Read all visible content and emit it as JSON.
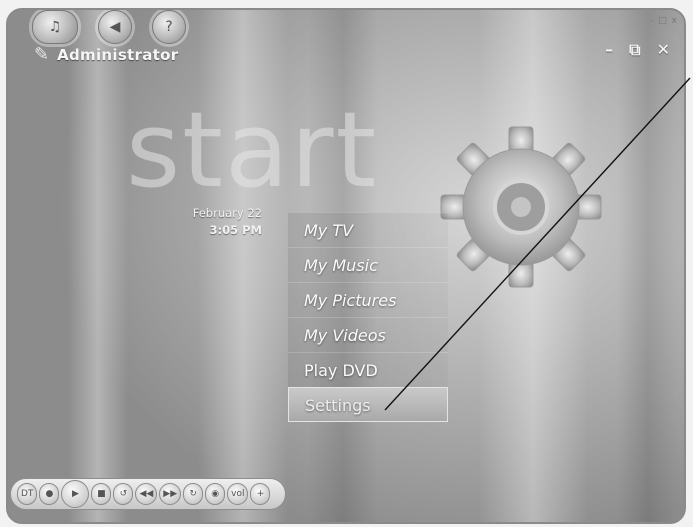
{
  "header": {
    "user_name": "Administrator",
    "title_mini": "- □ x",
    "minimize_label": "–",
    "restore_label": "⧉",
    "close_label": "✕"
  },
  "top_buttons": [
    {
      "icon": "media-center-logo-icon",
      "glyph": "♫"
    },
    {
      "icon": "back-icon",
      "glyph": "◀"
    },
    {
      "icon": "help-icon",
      "glyph": "?"
    }
  ],
  "watermark": {
    "text": "start"
  },
  "datetime": {
    "date": "February 22",
    "time": "3:05 PM"
  },
  "menu": {
    "items": [
      {
        "label": "My TV"
      },
      {
        "label": "My Music"
      },
      {
        "label": "My Pictures"
      },
      {
        "label": "My Videos"
      },
      {
        "label": "Play DVD"
      },
      {
        "label": "Settings"
      }
    ],
    "selected_index": 5
  },
  "transport": {
    "buttons": [
      {
        "name": "guide-button",
        "glyph": "DT"
      },
      {
        "name": "record-button",
        "glyph": "●"
      },
      {
        "name": "play-pause-button",
        "glyph": "▶"
      },
      {
        "name": "stop-button",
        "glyph": "■"
      },
      {
        "name": "replay-button",
        "glyph": "↺"
      },
      {
        "name": "rewind-button",
        "glyph": "◀◀"
      },
      {
        "name": "fast-forward-button",
        "glyph": "▶▶"
      },
      {
        "name": "skip-button",
        "glyph": "↻"
      },
      {
        "name": "mute-button",
        "glyph": "◉"
      },
      {
        "name": "volume-label",
        "glyph": "vol"
      },
      {
        "name": "volume-up-button",
        "glyph": "+"
      }
    ]
  },
  "colors": {
    "background_grey": "#a9a9a9",
    "selection_grey": "#bdbdbd",
    "text_light": "#fbfbfb"
  }
}
